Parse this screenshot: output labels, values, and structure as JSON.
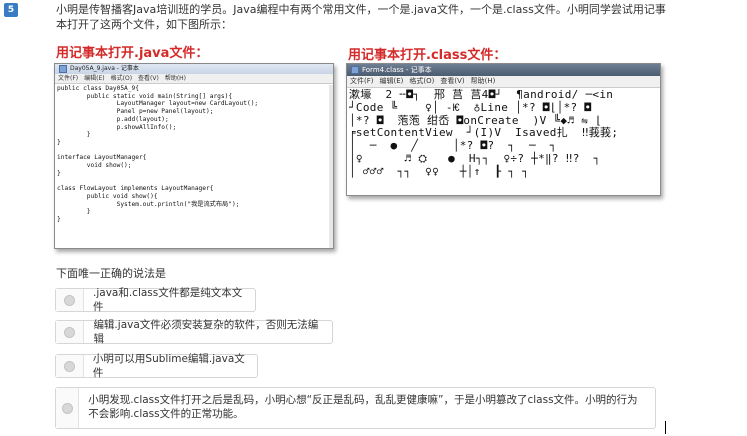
{
  "question": {
    "number": "5",
    "stem": "小明是传智播客Java培训班的学员。Java编程中有两个常用文件，一个是.java文件，一个是.class文件。小明同学尝试用记事本打开了这两个文件，如下图所示：",
    "caption_java": "用记事本打开.java文件：",
    "caption_class": "用记事本打开.class文件：",
    "prompt": "下面唯一正确的说法是"
  },
  "java_window": {
    "title": "Day05A_9.java - 记事本",
    "menu": [
      "文件(F)",
      "编辑(E)",
      "格式(O)",
      "查看(V)",
      "帮助(H)"
    ],
    "code": "public class Day05A_9{\n        public static void main(String[] args){\n                LayoutManager layout=new CardLayout();\n                Panel p=new Panel(layout);\n                p.add(layout);\n                p.showAllInfo();\n        }\n}\n\ninterface LayoutManager{\n        void show();\n}\n\nclass FlowLayout implements LayoutManager{\n        public void show(){\n                System.out.println(\"我是流式布局\");\n        }\n}"
  },
  "class_window": {
    "title": "Form4.class - 记事本",
    "menu": [
      "文件(F)",
      "编辑(E)",
      "格式(O)",
      "查看(V)",
      "帮助(H)"
    ],
    "content": "漱壕  2 ╌◘┐  郉 莒 莒4◘┘  ¶android/ ─<in\n┘Code ╚    ♀│ -Ѥ  ♁Line │*? ◘⌊│*? ◘\n│*? ◘  萢萢 绀岙 ◘onCreate  )V ╚◆♬ ⇋ ⌊\n╒setContentView  ┘(I)V  Isaved扎  ‼莪莪;\n│  ─  ●  ╱     │*? ◘?  ┐  ─  ┐\n│♀      ♬ ⛭   ●  H┐┐  ♀÷? ┼*‖? ‼?  ┐\n│ ♂♂♂  ┐┐  ♀♀   ┼│↑  ┠ ┐ ┐"
  },
  "options": [
    {
      "label": ".java和.class文件都是纯文本文件"
    },
    {
      "label": "编辑.java文件必须安装复杂的软件，否则无法编辑"
    },
    {
      "label": "小明可以用Sublime编辑.java文件"
    },
    {
      "label": "小明发现.class文件打开之后是乱码，小明心想“反正是乱码，乱乱更健康嘛”，于是小明篡改了class文件。小明的行为不会影响.class文件的正常功能。"
    }
  ]
}
